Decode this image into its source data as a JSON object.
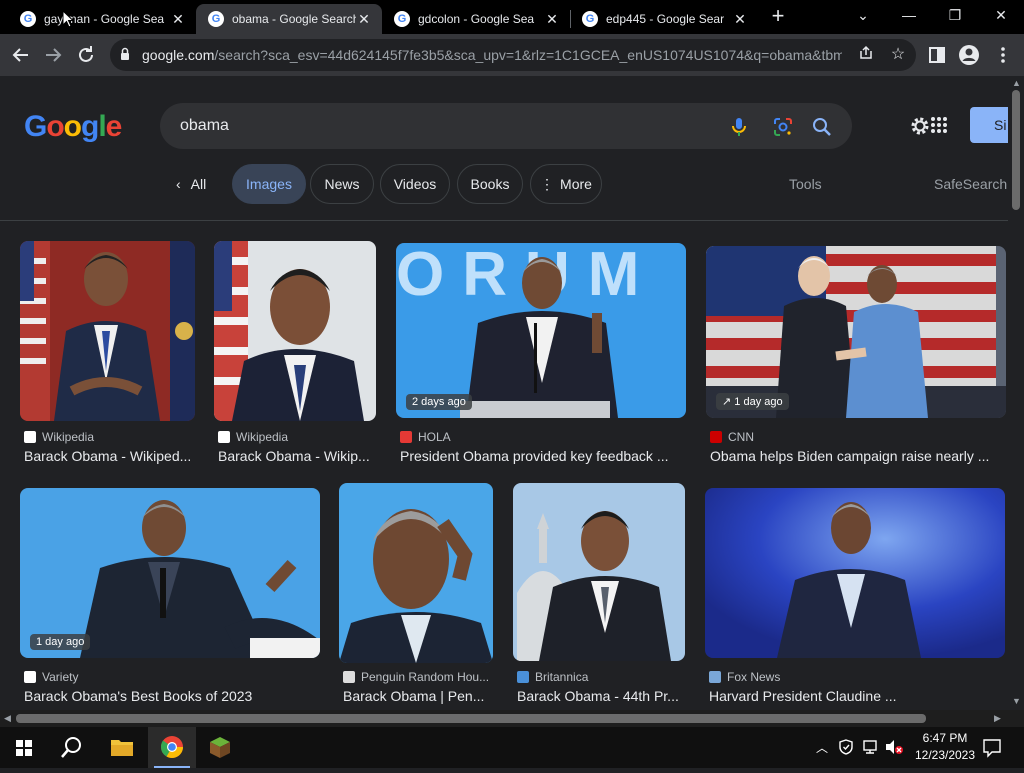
{
  "tabs": [
    {
      "title": "gay man - Google Sea",
      "active": false
    },
    {
      "title": "obama - Google Search",
      "active": true
    },
    {
      "title": "gdcolon - Google Sea",
      "active": false
    },
    {
      "title": "edp445 - Google Sear",
      "active": false
    }
  ],
  "window_controls": {
    "chevron": "⌄",
    "minimize": "—",
    "maximize": "❐",
    "close": "✕"
  },
  "toolbar": {
    "url_host": "google.com",
    "url_path": "/search?sca_esv=44d624145f7fe3b5&sca_upv=1&rlz=1C1GCEA_enUS1074US1074&q=obama&tbm..."
  },
  "search": {
    "logo": "Google",
    "query": "obama",
    "signin_label": "Si"
  },
  "filters": {
    "all": "All",
    "chips": [
      "Images",
      "News",
      "Videos",
      "Books",
      "More"
    ],
    "tools": "Tools",
    "safesearch": "SafeSearch"
  },
  "results": [
    {
      "source": "Wikipedia",
      "title": "Barack Obama - Wikiped...",
      "badge": "",
      "icon": "wikipedia-icon",
      "icon_color": "#ffffff"
    },
    {
      "source": "Wikipedia",
      "title": "Barack Obama - Wikip...",
      "badge": "",
      "icon": "wikipedia-icon",
      "icon_color": "#ffffff"
    },
    {
      "source": "HOLA",
      "title": "President Obama provided key feedback ...",
      "badge": "2 days ago",
      "icon": "hola-icon",
      "icon_color": "#e53935"
    },
    {
      "source": "CNN",
      "title": "Obama helps Biden campaign raise nearly ...",
      "badge": "1 day ago",
      "icon": "cnn-icon",
      "icon_color": "#cc0000"
    },
    {
      "source": "Variety",
      "title": "Barack Obama's Best Books of 2023",
      "badge": "1 day ago",
      "icon": "variety-icon",
      "icon_color": "#ffffff"
    },
    {
      "source": "Penguin Random Hou...",
      "title": "Barack Obama | Pen...",
      "badge": "",
      "icon": "penguin-icon",
      "icon_color": "#dddddd"
    },
    {
      "source": "Britannica",
      "title": "Barack Obama - 44th Pr...",
      "badge": "",
      "icon": "britannica-icon",
      "icon_color": "#4a90d9"
    },
    {
      "source": "Fox News",
      "title": "Harvard President Claudine ...",
      "badge": "",
      "icon": "foxnews-icon",
      "icon_color": "#7aa7d8"
    }
  ],
  "taskbar": {
    "time": "6:47 PM",
    "date": "12/23/2023"
  },
  "colors": {
    "accent": "#8ab4f8",
    "background": "#202124"
  }
}
